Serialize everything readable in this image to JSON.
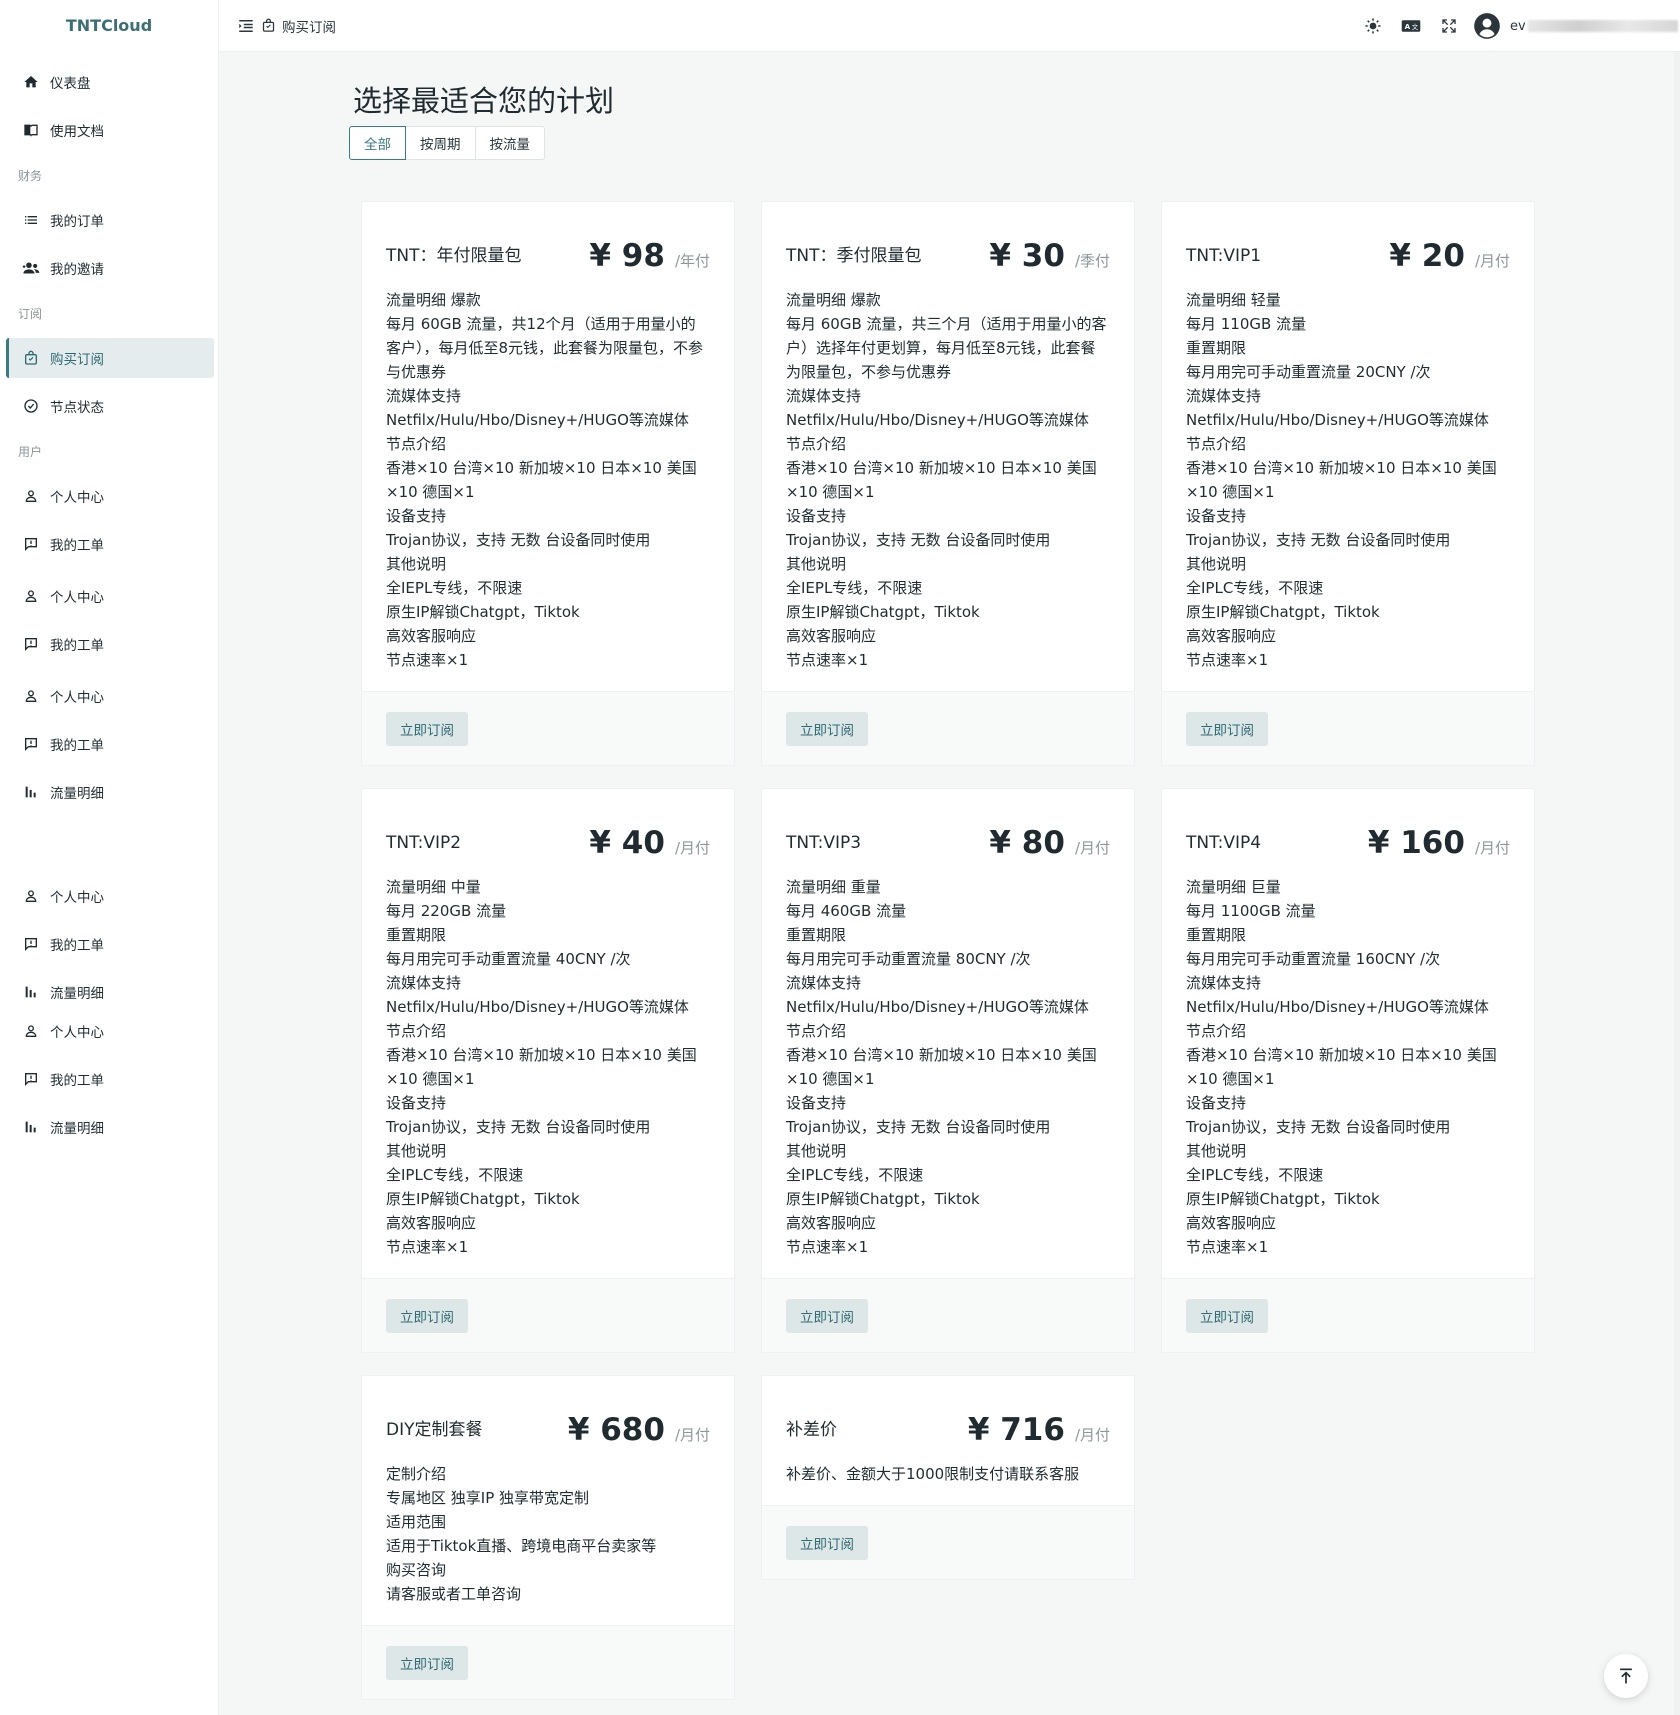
{
  "brand": "TNTCloud",
  "sidebar": {
    "sections": {
      "finance": "财务",
      "subscription": "订阅",
      "user": "用户"
    },
    "items": [
      {
        "label": "仪表盘",
        "icon": "home-icon"
      },
      {
        "label": "使用文档",
        "icon": "book-icon"
      },
      {
        "label": "我的订单",
        "icon": "list-icon"
      },
      {
        "label": "我的邀请",
        "icon": "people-icon"
      },
      {
        "label": "购买订阅",
        "icon": "shopping-bag-icon",
        "active": true
      },
      {
        "label": "节点状态",
        "icon": "check-circle-icon"
      },
      {
        "label": "个人中心",
        "icon": "person-icon"
      },
      {
        "label": "我的工单",
        "icon": "feedback-icon"
      },
      {
        "label": "个人中心",
        "icon": "person-icon"
      },
      {
        "label": "我的工单",
        "icon": "feedback-icon"
      },
      {
        "label": "个人中心",
        "icon": "person-icon"
      },
      {
        "label": "我的工单",
        "icon": "feedback-icon"
      },
      {
        "label": "流量明细",
        "icon": "bar-chart-icon"
      },
      {
        "label": "个人中心",
        "icon": "person-icon"
      },
      {
        "label": "我的工单",
        "icon": "feedback-icon"
      },
      {
        "label": "流量明细",
        "icon": "bar-chart-icon"
      },
      {
        "label": "个人中心",
        "icon": "person-icon"
      },
      {
        "label": "我的工单",
        "icon": "feedback-icon"
      },
      {
        "label": "流量明细",
        "icon": "bar-chart-icon"
      }
    ]
  },
  "header": {
    "breadcrumb": "购买订阅",
    "username_prefix": "ev"
  },
  "main": {
    "title": "选择最适合您的计划",
    "tabs": [
      "全部",
      "按周期",
      "按流量"
    ],
    "subscribe_label": "立即订阅",
    "plans": [
      {
        "name": "TNT：年付限量包",
        "price": "¥ 98",
        "unit": "/年付",
        "lines": [
          "流量明细 爆款",
          "每月 60GB 流量，共12个月（适用于用量小的客户），每月低至8元钱，此套餐为限量包，不参与优惠券",
          "流媒体支持",
          "Netfilx/Hulu/Hbo/Disney+/HUGO等流媒体",
          "节点介绍",
          "香港×10 台湾×10 新加坡×10 日本×10 美国×10 德国×1",
          "设备支持",
          "Trojan协议，支持 无数 台设备同时使用",
          "其他说明",
          "全IEPL专线，不限速",
          "原生IP解锁Chatgpt，Tiktok",
          "高效客服响应",
          "节点速率×1"
        ]
      },
      {
        "name": "TNT：季付限量包",
        "price": "¥ 30",
        "unit": "/季付",
        "lines": [
          "流量明细 爆款",
          "每月 60GB 流量，共三个月（适用于用量小的客户）选择年付更划算，每月低至8元钱，此套餐为限量包，不参与优惠券",
          "流媒体支持",
          "Netfilx/Hulu/Hbo/Disney+/HUGO等流媒体",
          "节点介绍",
          "香港×10 台湾×10 新加坡×10 日本×10 美国×10 德国×1",
          "设备支持",
          "Trojan协议，支持 无数 台设备同时使用",
          "其他说明",
          "全IEPL专线，不限速",
          "原生IP解锁Chatgpt，Tiktok",
          "高效客服响应",
          "节点速率×1"
        ]
      },
      {
        "name": "TNT:VIP1",
        "price": "¥ 20",
        "unit": "/月付",
        "lines": [
          "流量明细 轻量",
          "每月 110GB 流量",
          "重置期限",
          "每月用完可手动重置流量 20CNY /次",
          "流媒体支持",
          "Netfilx/Hulu/Hbo/Disney+/HUGO等流媒体",
          "节点介绍",
          "香港×10 台湾×10 新加坡×10 日本×10 美国×10 德国×1",
          "设备支持",
          "Trojan协议，支持 无数 台设备同时使用",
          "其他说明",
          "全IPLC专线，不限速",
          "原生IP解锁Chatgpt，Tiktok",
          "高效客服响应",
          "节点速率×1"
        ]
      },
      {
        "name": "TNT:VIP2",
        "price": "¥ 40",
        "unit": "/月付",
        "lines": [
          "流量明细 中量",
          "每月 220GB 流量",
          "重置期限",
          "每月用完可手动重置流量 40CNY /次",
          "流媒体支持",
          "Netfilx/Hulu/Hbo/Disney+/HUGO等流媒体",
          "节点介绍",
          "香港×10 台湾×10 新加坡×10 日本×10 美国×10 德国×1",
          "设备支持",
          "Trojan协议，支持 无数 台设备同时使用",
          "其他说明",
          "全IPLC专线，不限速",
          "原生IP解锁Chatgpt，Tiktok",
          "高效客服响应",
          "节点速率×1"
        ]
      },
      {
        "name": "TNT:VIP3",
        "price": "¥ 80",
        "unit": "/月付",
        "lines": [
          "流量明细 重量",
          "每月 460GB 流量",
          "重置期限",
          "每月用完可手动重置流量 80CNY /次",
          "流媒体支持",
          "Netfilx/Hulu/Hbo/Disney+/HUGO等流媒体",
          "节点介绍",
          "香港×10 台湾×10 新加坡×10 日本×10 美国×10 德国×1",
          "设备支持",
          "Trojan协议，支持 无数 台设备同时使用",
          "其他说明",
          "全IPLC专线，不限速",
          "原生IP解锁Chatgpt，Tiktok",
          "高效客服响应",
          "节点速率×1"
        ]
      },
      {
        "name": "TNT:VIP4",
        "price": "¥ 160",
        "unit": "/月付",
        "lines": [
          "流量明细 巨量",
          "每月 1100GB 流量",
          "重置期限",
          "每月用完可手动重置流量 160CNY /次",
          "流媒体支持",
          "Netfilx/Hulu/Hbo/Disney+/HUGO等流媒体",
          "节点介绍",
          "香港×10 台湾×10 新加坡×10 日本×10 美国×10 德国×1",
          "设备支持",
          "Trojan协议，支持 无数 台设备同时使用",
          "其他说明",
          "全IPLC专线，不限速",
          "原生IP解锁Chatgpt，Tiktok",
          "高效客服响应",
          "节点速率×1"
        ]
      },
      {
        "name": "DIY定制套餐",
        "price": "¥ 680",
        "unit": "/月付",
        "lines": [
          "定制介绍",
          "专属地区 独享IP 独享带宽定制",
          "适用范围",
          "适用于Tiktok直播、跨境电商平台卖家等",
          "购买咨询",
          "请客服或者工单咨询"
        ]
      },
      {
        "name": "补差价",
        "price": "¥ 716",
        "unit": "/月付",
        "lines": [
          "补差价、金额大于1000限制支付请联系客服"
        ]
      }
    ]
  },
  "colors": {
    "accent": "#3a7a83",
    "sidebar_active_bg": "#e4eced",
    "button_bg": "#dde7e8"
  }
}
